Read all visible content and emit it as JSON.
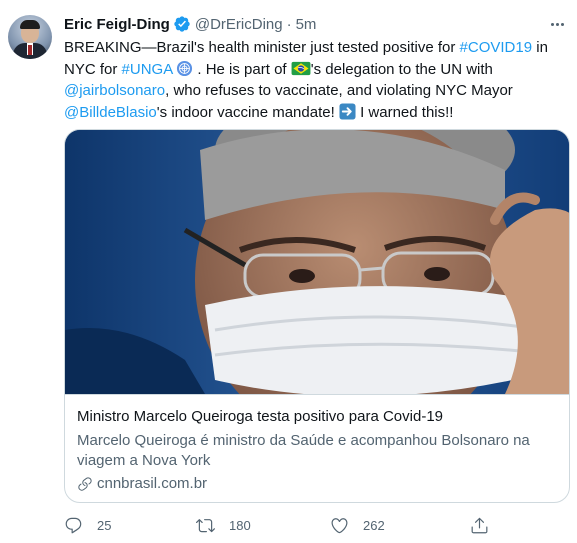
{
  "author": {
    "name": "Eric Feigl-Ding",
    "handle": "@DrEricDing",
    "separator": "·",
    "time": "5m"
  },
  "tweet": {
    "line1": {
      "t1": "BREAKING—Brazil's health minister just tested positive for ",
      "h1": "#COVID19",
      "t2": " in"
    },
    "line2": {
      "t1": "NYC for ",
      "h1": "#UNGA",
      "t2": " . He is part of ",
      "t3": "'s delegation to the UN with"
    },
    "line3": {
      "m1": "@jairbolsonaro",
      "t1": ", who refuses to vaccinate, and violating NYC Mayor"
    },
    "line4": {
      "m1": "@BilldeBlasio",
      "t1": "'s indoor vaccine mandate! ",
      "t2": " I warned this!!"
    }
  },
  "card": {
    "title": "Ministro Marcelo Queiroga testa positivo para Covid-19",
    "description": "Marcelo Queiroga é ministro da Saúde e acompanhou Bolsonaro na viagem a Nova York",
    "domain": "cnnbrasil.com.br"
  },
  "actions": {
    "replies": "25",
    "retweets": "180",
    "likes": "262"
  },
  "icons": {
    "verified": "verified-badge-icon",
    "more": "more-options-icon",
    "un": "united-nations-emoji",
    "flag": "brazil-flag-emoji",
    "arrow": "right-arrow-emoji",
    "link": "link-icon",
    "reply": "reply-icon",
    "retweet": "retweet-icon",
    "like": "like-icon",
    "share": "share-icon"
  },
  "colors": {
    "link": "#1d9bf0",
    "text": "#0f1419",
    "secondary": "#536471",
    "border": "#cfd9de"
  }
}
